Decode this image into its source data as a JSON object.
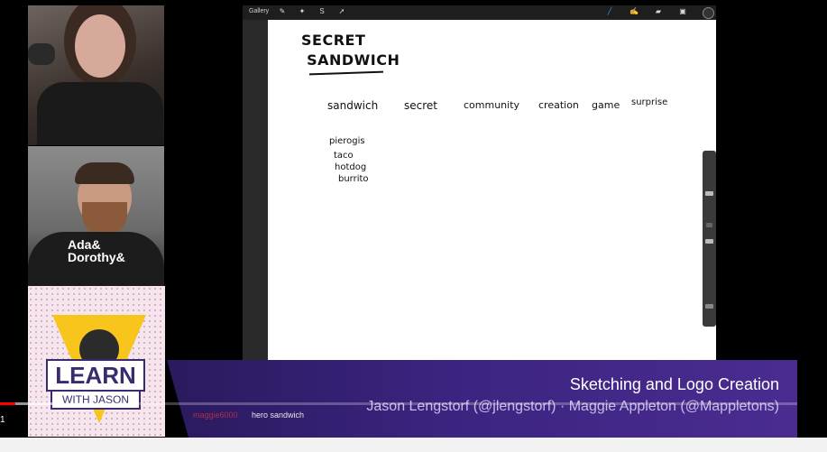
{
  "procreate": {
    "gallery_label": "Gallery",
    "toolbar_left_icons": [
      "wrench-icon",
      "magic-wand-icon",
      "selection-icon",
      "transform-icon"
    ],
    "toolbar_right_icons": [
      "brush-icon",
      "smudge-icon",
      "eraser-icon",
      "layers-icon",
      "color-icon"
    ]
  },
  "canvas": {
    "title": "SECRET\n SANDWICH",
    "words": [
      "sandwich",
      "secret",
      "community",
      "creation",
      "game",
      "surprise"
    ],
    "list": [
      "pierogis",
      "taco",
      "hotdog",
      "burrito"
    ]
  },
  "webcams": {
    "shirt_text": "Ada&\nDorothy&"
  },
  "branding": {
    "learn": "LEARN",
    "with_jason": "WITH JASON"
  },
  "lower_third": {
    "title": "Sketching and Logo Creation",
    "guests": "Jason Lengstorf (@jlengstorf) · Maggie Appleton (@Mappletons)"
  },
  "chat": {
    "username": "maggie6000",
    "message": "hero sandwich"
  },
  "player": {
    "time": "1",
    "progress": 0.019,
    "buffered": 0.068
  },
  "colors": {
    "banner": "#3b2480",
    "logo_yellow": "#f7c51b",
    "progress_red": "#ff0000"
  }
}
